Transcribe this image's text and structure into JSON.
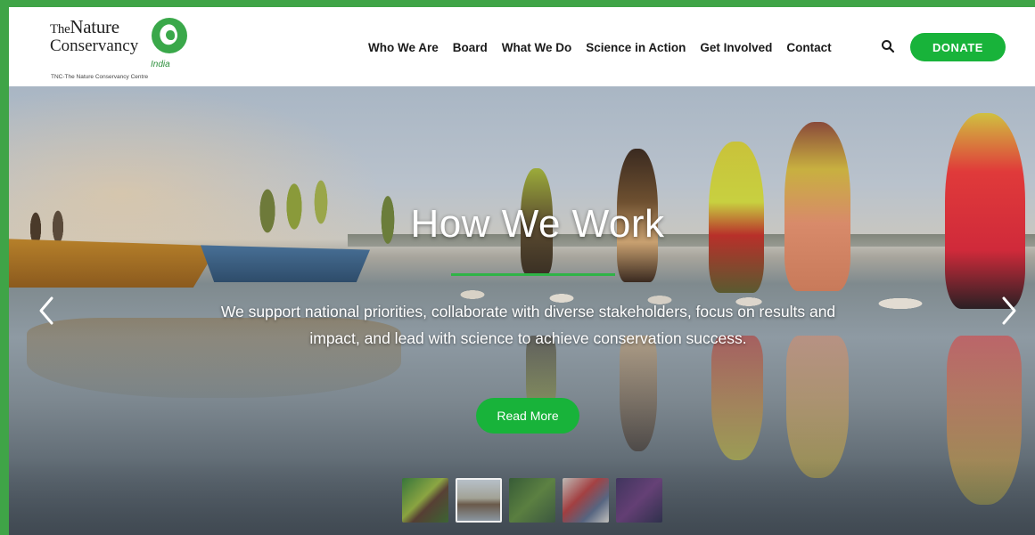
{
  "header": {
    "logo": {
      "the": "The",
      "nature": "Nature",
      "conservancy": "Conservancy",
      "country": "India",
      "tagline": "TNC-The Nature Conservancy Centre"
    },
    "nav": [
      {
        "label": "Who We Are"
      },
      {
        "label": "Board"
      },
      {
        "label": "What We Do"
      },
      {
        "label": "Science in Action"
      },
      {
        "label": "Get Involved"
      },
      {
        "label": "Contact"
      }
    ],
    "search_icon": "search-icon",
    "donate_label": "DONATE"
  },
  "hero": {
    "title": "How We Work",
    "description": "We support national priorities, collaborate with diverse stakeholders, focus on results and impact, and lead with science to achieve conservation success.",
    "cta_label": "Read More",
    "prev_icon": "chevron-left-icon",
    "next_icon": "chevron-right-icon",
    "thumbnails": 5,
    "active_thumbnail": 2
  },
  "colors": {
    "frame": "#3fa447",
    "accent_green": "#18b33a",
    "title_underline": "#2fb447",
    "nav_text": "#1a1a1a"
  }
}
